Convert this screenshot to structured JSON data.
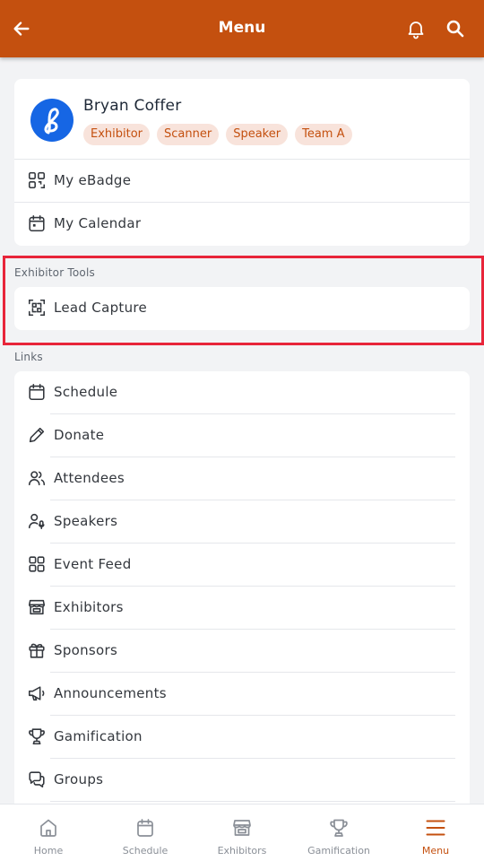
{
  "header": {
    "title": "Menu"
  },
  "profile": {
    "name": "Bryan Coffer",
    "tags": [
      "Exhibitor",
      "Scanner",
      "Speaker",
      "Team A"
    ],
    "items": [
      {
        "label": "My eBadge",
        "icon": "qr-code-icon"
      },
      {
        "label": "My Calendar",
        "icon": "calendar-icon"
      }
    ]
  },
  "exhibitor_tools": {
    "title": "Exhibitor Tools",
    "items": [
      {
        "label": "Lead Capture",
        "icon": "qr-scan-icon"
      }
    ]
  },
  "links": {
    "title": "Links",
    "items": [
      {
        "label": "Schedule",
        "icon": "calendar-icon"
      },
      {
        "label": "Donate",
        "icon": "pencil-icon"
      },
      {
        "label": "Attendees",
        "icon": "users-icon"
      },
      {
        "label": "Speakers",
        "icon": "speaker-user-icon"
      },
      {
        "label": "Event Feed",
        "icon": "grid-icon"
      },
      {
        "label": "Exhibitors",
        "icon": "store-icon"
      },
      {
        "label": "Sponsors",
        "icon": "gift-icon"
      },
      {
        "label": "Announcements",
        "icon": "megaphone-icon"
      },
      {
        "label": "Gamification",
        "icon": "trophy-icon"
      },
      {
        "label": "Groups",
        "icon": "chat-bubbles-icon"
      }
    ]
  },
  "bottom_nav": {
    "items": [
      {
        "label": "Home",
        "icon": "home-icon",
        "active": false
      },
      {
        "label": "Schedule",
        "icon": "calendar-icon",
        "active": false
      },
      {
        "label": "Exhibitors",
        "icon": "store-icon",
        "active": false
      },
      {
        "label": "Gamification",
        "icon": "trophy-icon",
        "active": false
      },
      {
        "label": "Menu",
        "icon": "menu-icon",
        "active": true
      }
    ]
  },
  "colors": {
    "brand": "#c4500f",
    "tag_bg": "#f8e3db",
    "highlight": "#e8253a",
    "avatar_bg": "#1666e4"
  }
}
